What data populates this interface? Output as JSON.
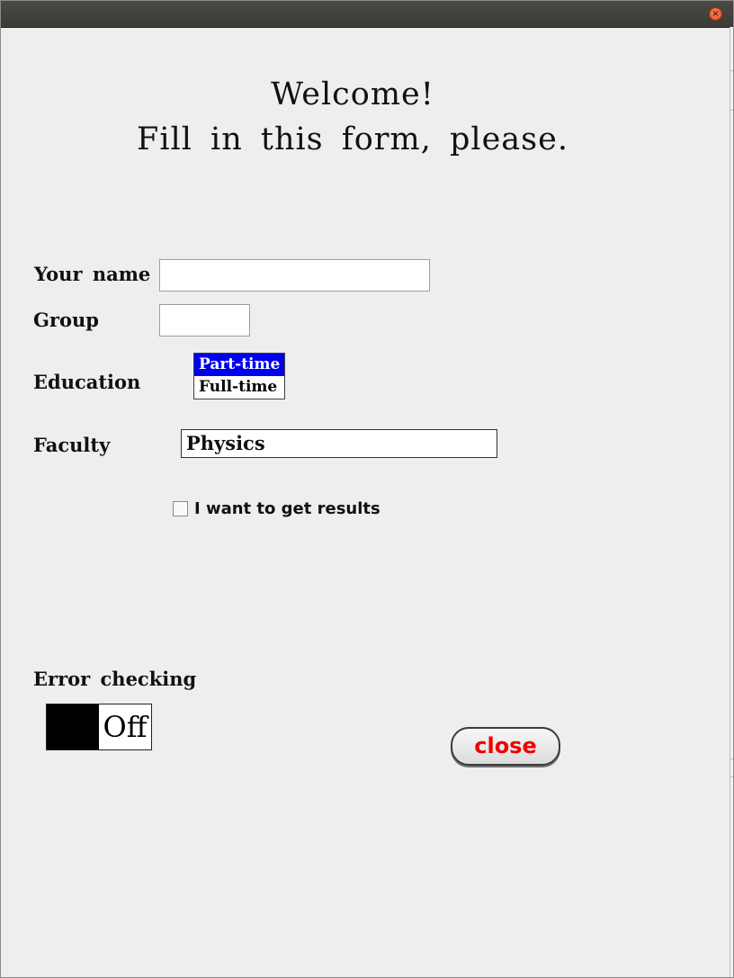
{
  "window": {
    "close_icon": "close-icon"
  },
  "header": {
    "welcome": "Welcome!",
    "instruction": "Fill in this form, please."
  },
  "form": {
    "name_label": "Your name",
    "name_value": "",
    "group_label": "Group",
    "group_value": "",
    "education_label": "Education",
    "education_options": [
      "Part-time",
      "Full-time"
    ],
    "education_selected": "Part-time",
    "faculty_label": "Faculty",
    "faculty_value": "Physics",
    "results_checkbox_label": "I want to get results",
    "results_checked": false,
    "error_checking_label": "Error checking",
    "error_checking_state": "Off",
    "close_label": "close"
  },
  "colors": {
    "selection": "#0000ee",
    "close_text": "#ee0000",
    "background": "#eeeeee"
  }
}
